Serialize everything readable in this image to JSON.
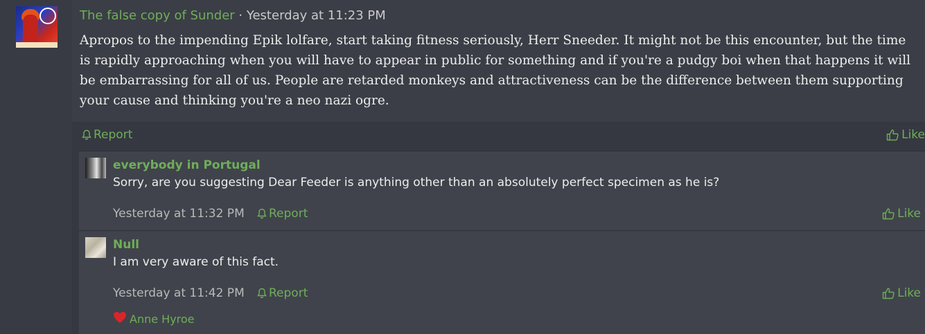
{
  "post": {
    "username": "The false copy of Sunder",
    "separator": "·",
    "timestamp": "Yesterday at 11:23 PM",
    "message": "Apropos to the impending Epik lolfare, start taking fitness seriously, Herr Sneeder. It might not be this encounter, but the time is rapidly approaching when you will have to appear in public for something and if you're a pudgy boi when that happens it will be embarrassing for all of us. People are retarded monkeys and attractiveness can be the difference between them supporting your cause and thinking you're a neo nazi ogre.",
    "report_label": "Report",
    "like_label": "Like"
  },
  "replies": [
    {
      "username": "everybody in Portugal",
      "text": "Sorry, are you suggesting Dear Feeder is anything other than an absolutely perfect specimen as he is?",
      "timestamp": "Yesterday at 11:32 PM",
      "report_label": "Report",
      "like_label": "Like"
    },
    {
      "username": "Null",
      "text": "I am very aware of this fact.",
      "timestamp": "Yesterday at 11:42 PM",
      "report_label": "Report",
      "like_label": "Like",
      "reaction": {
        "icon": "heart-icon",
        "user": "Anne Hyroe"
      }
    }
  ],
  "colors": {
    "accent": "#6fae5a",
    "background": "#353840",
    "text": "#ededed"
  }
}
